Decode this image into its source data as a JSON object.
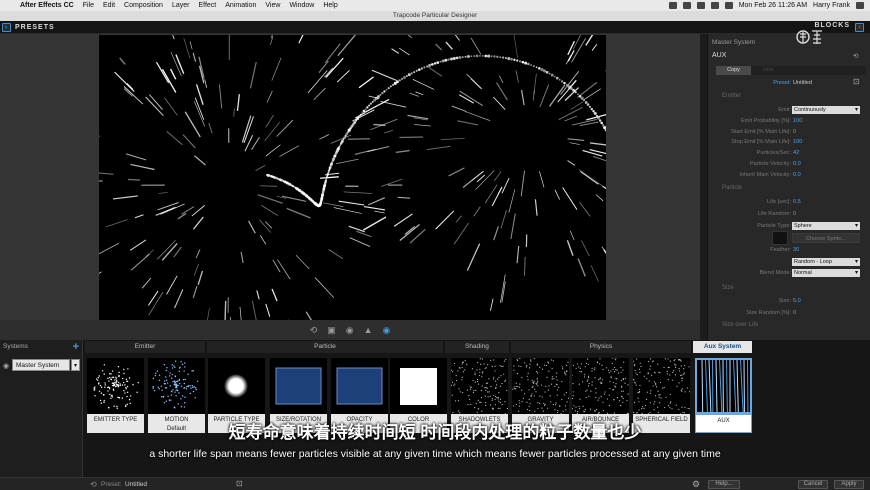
{
  "menubar": {
    "items": [
      "After Effects CC",
      "File",
      "Edit",
      "Composition",
      "Layer",
      "Effect",
      "Animation",
      "View",
      "Window",
      "Help"
    ],
    "clock": "Mon Feb 26  11:26 AM",
    "user": "Harry Frank"
  },
  "window_title": "Trapcode Particular Designer",
  "topbar": {
    "presets_label": "PRESETS",
    "blocks_label": "BLOCKS"
  },
  "right_panel": {
    "heading": "Master System",
    "system_name": "AUX",
    "tabs": [
      "Copy",
      "Hide"
    ],
    "preset_label": "Preset:",
    "preset_value": "Untitled",
    "sections": {
      "emitter": "Emitter",
      "particle": "Particle",
      "size": "Size",
      "size_over_life": "Size over Life"
    },
    "emitter_rows": [
      {
        "label": "Emit:",
        "value": "Continuously",
        "kind": "dropdown"
      },
      {
        "label": "Emit Probability [%]:",
        "value": "100"
      },
      {
        "label": "Start Emit [% Main Life]:",
        "value": "0"
      },
      {
        "label": "Stop Emit [% Main Life]:",
        "value": "100"
      },
      {
        "label": "Particles/Sec:",
        "value": "42"
      },
      {
        "label": "Particle Velocity:",
        "value": "0.0"
      },
      {
        "label": "Inherit Main Velocity:",
        "value": "0.0"
      }
    ],
    "particle_rows": [
      {
        "label": "Life [sec]:",
        "value": "0.5"
      },
      {
        "label": "Life Random:",
        "value": "0"
      },
      {
        "label": "Particle Type:",
        "value": "Sphere",
        "kind": "dropdown"
      },
      {
        "label": "",
        "value": "Choose Sprite...",
        "kind": "button"
      },
      {
        "label": "Feather:",
        "value": "30"
      },
      {
        "label": "",
        "value": "Random - Loop",
        "kind": "dropdown"
      },
      {
        "label": "Blend Mode:",
        "value": "Normal",
        "kind": "dropdown"
      }
    ],
    "size_rows": [
      {
        "label": "Size:",
        "value": "5.0"
      },
      {
        "label": "Size Random [%]:",
        "value": "0"
      }
    ]
  },
  "systems": {
    "header": "Systems",
    "selected": "Master System"
  },
  "groups": [
    "Emitter",
    "Particle",
    "Shading",
    "Physics",
    "Aux System"
  ],
  "tiles": [
    {
      "name": "EMITTER TYPE",
      "sub": ""
    },
    {
      "name": "MOTION",
      "sub": "Default"
    },
    {
      "name": "PARTICLE TYPE",
      "sub": ""
    },
    {
      "name": "SIZE/ROTATION",
      "sub": ""
    },
    {
      "name": "OPACITY",
      "sub": ""
    },
    {
      "name": "COLOR",
      "sub": ""
    },
    {
      "name": "SHADOWLETS",
      "sub": ""
    },
    {
      "name": "GRAVITY",
      "sub": ""
    },
    {
      "name": "AIR/BOUNCE",
      "sub": ""
    },
    {
      "name": "SPHERICAL FIELD",
      "sub": ""
    },
    {
      "name": "AUX",
      "sub": ""
    }
  ],
  "footer": {
    "preset_label": "Preset:",
    "preset_value": "Untitled",
    "help": "Help...",
    "cancel": "Cancel",
    "apply": "Apply"
  },
  "subtitles": {
    "chinese": "短寿命意味着持续时间短 时间段内处理的粒子数量也少",
    "english": "a shorter life span means fewer particles visible at any given time which means fewer particles processed at any given time"
  },
  "colors": {
    "accent": "#3ea0e0",
    "value_text": "#4aa3e8",
    "aux_highlight": "#6aa8e0"
  }
}
